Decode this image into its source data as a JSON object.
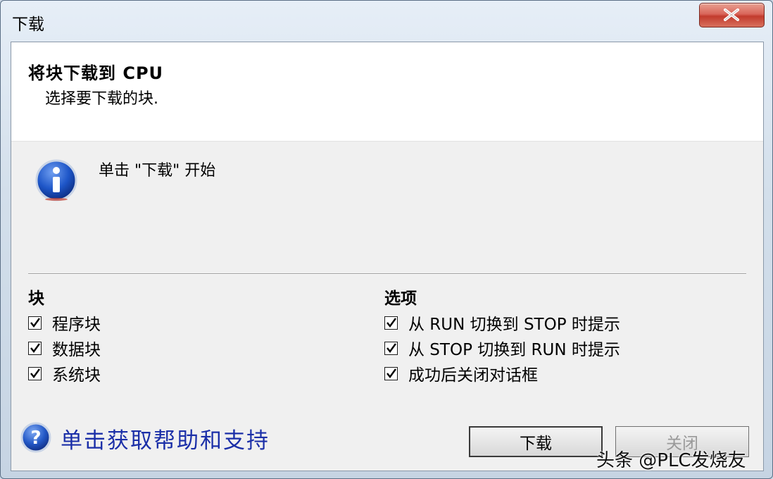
{
  "window": {
    "title": "下载"
  },
  "header": {
    "title": "将块下载到 CPU",
    "subtitle": "选择要下载的块."
  },
  "info": {
    "icon": "info-icon",
    "text": "单击 \"下载\" 开始"
  },
  "blocks": {
    "title": "块",
    "items": [
      {
        "label": "程序块",
        "checked": true
      },
      {
        "label": "数据块",
        "checked": true
      },
      {
        "label": "系统块",
        "checked": true
      }
    ]
  },
  "options": {
    "title": "选项",
    "items": [
      {
        "label": "从 RUN 切换到 STOP 时提示",
        "checked": true
      },
      {
        "label": "从 STOP 切换到 RUN 时提示",
        "checked": true
      },
      {
        "label": "成功后关闭对话框",
        "checked": true
      }
    ]
  },
  "help": {
    "icon": "help-icon",
    "text": "单击获取帮助和支持"
  },
  "buttons": {
    "download": "下载",
    "close": "关闭"
  },
  "watermark": "头条 @PLC发烧友",
  "colors": {
    "link": "#1b2fa8",
    "close_button": "#c23b2d"
  }
}
